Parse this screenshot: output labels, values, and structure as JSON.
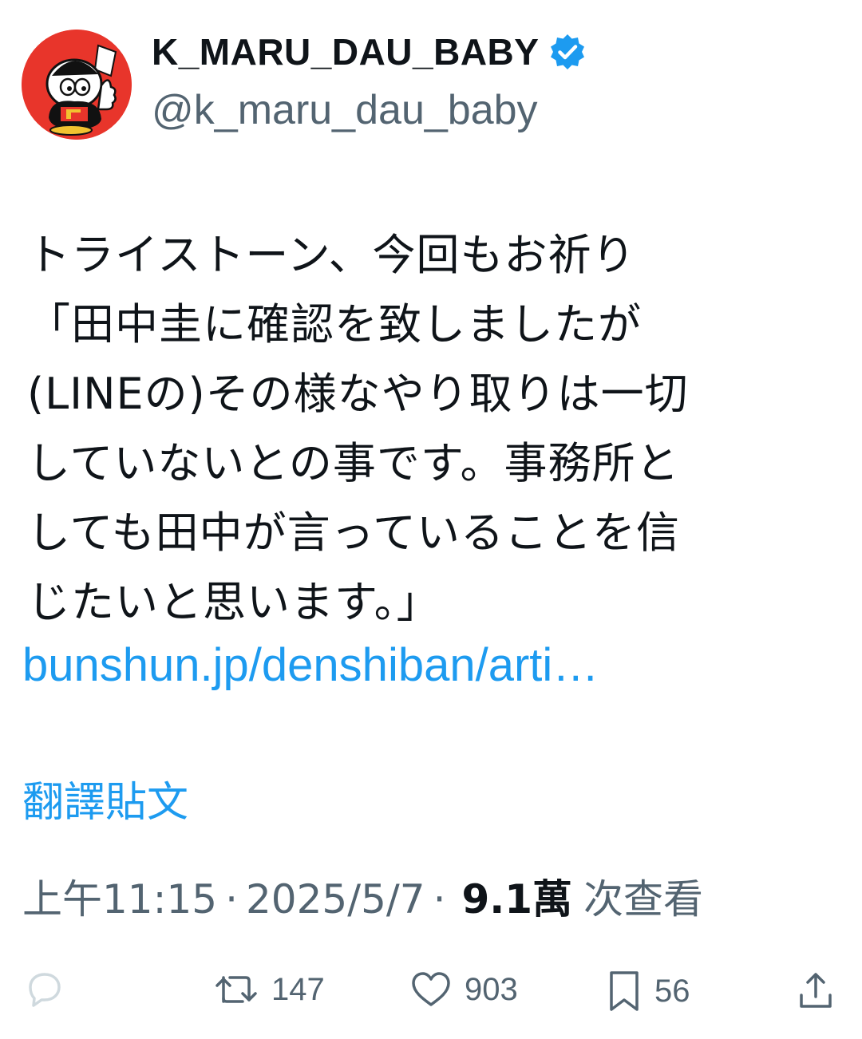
{
  "author": {
    "display_name": "K_MARU_DAU_BABY",
    "handle": "@k_maru_dau_baby",
    "verified_icon": "verified-badge-icon",
    "avatar_icon": "cartoon-mascot-avatar"
  },
  "tweet": {
    "lines": [
      "トライストーン、今回もお祈り",
      "「田中圭に確認を致しましたが",
      "(LINEの)その様なやり取りは一切",
      "していないとの事です。事務所と",
      "しても田中が言っていることを信",
      "じたいと思います。」"
    ],
    "link": "bunshun.jp/denshiban/arti…"
  },
  "translate_label": "翻譯貼文",
  "meta": {
    "time": "上午11:15",
    "date": "2025/5/7",
    "separator": "·",
    "views_count": "9.1萬",
    "views_label": "次查看"
  },
  "actions": {
    "retweets": "147",
    "likes": "903",
    "bookmarks": "56"
  },
  "colors": {
    "accent": "#1d9bf0",
    "secondary_text": "#536471",
    "primary_text": "#0f1419",
    "avatar_red": "#e8352b"
  }
}
